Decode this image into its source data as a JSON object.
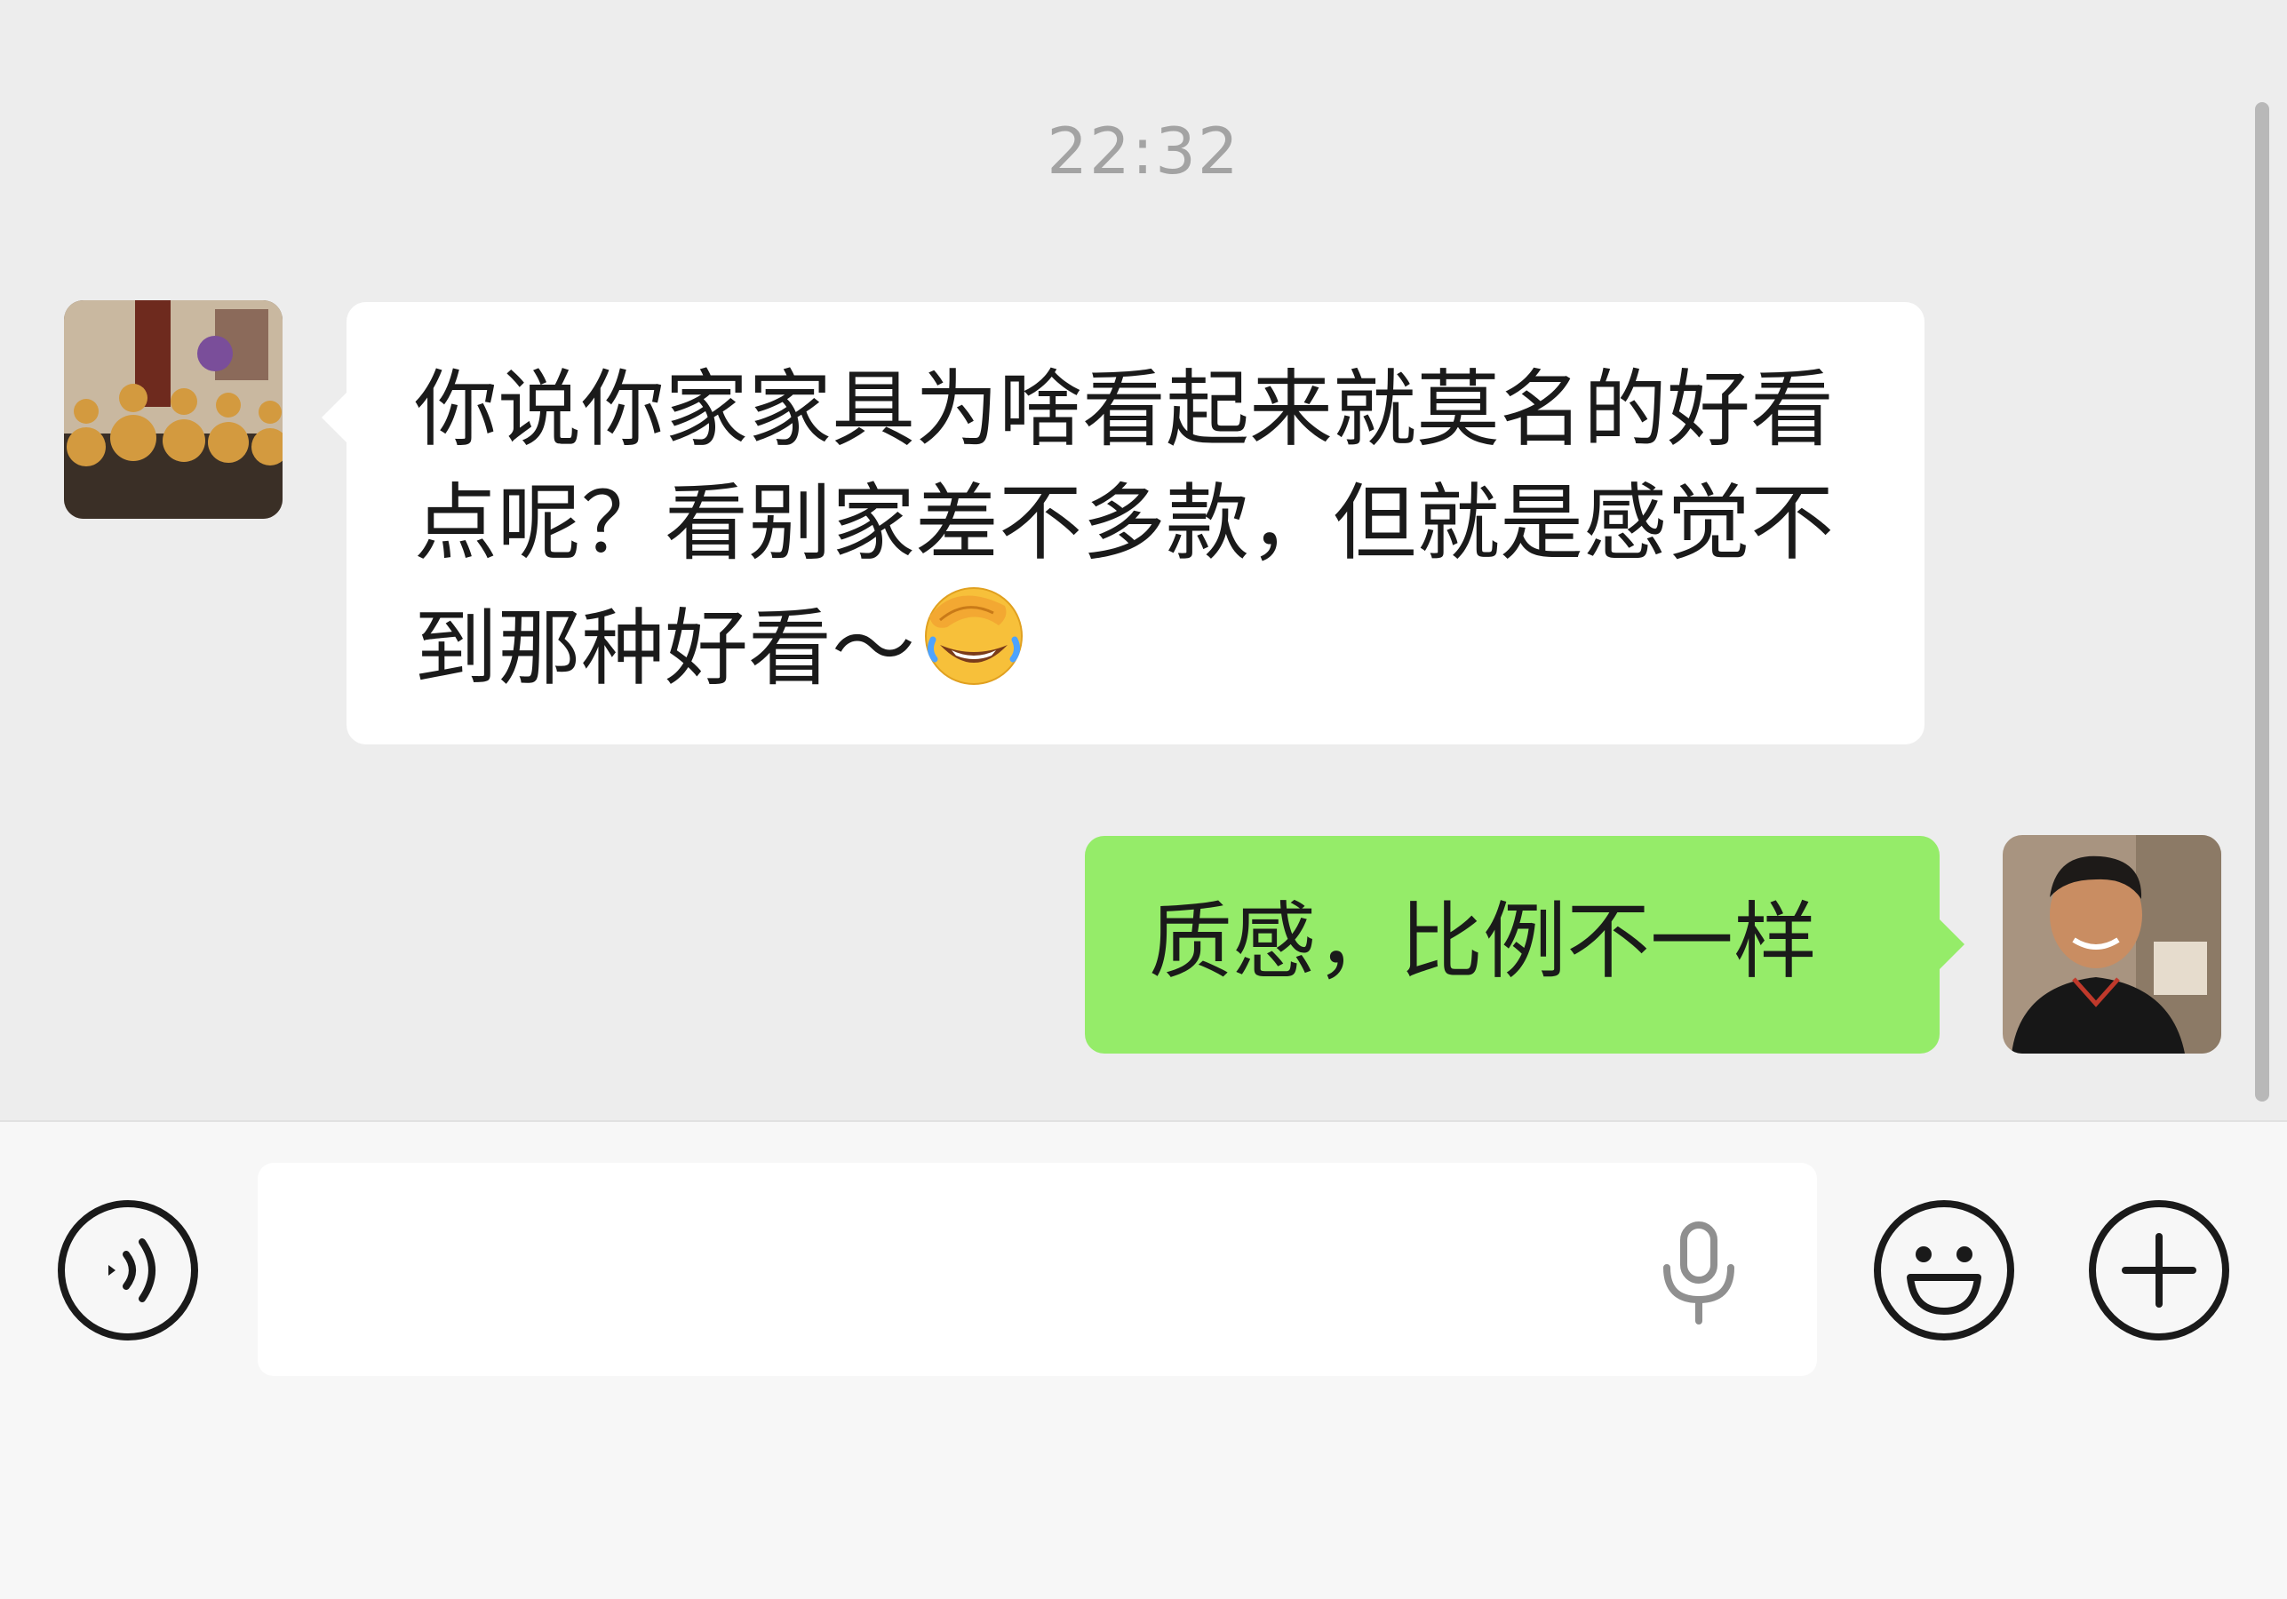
{
  "chat": {
    "timestamp": "22:32",
    "messages": [
      {
        "side": "left",
        "text": "你说你家家具为啥看起来就莫名的好看点呢？看别家差不多款，但就是感觉不到那种好看～",
        "emoji": "face-palm-laughing-emoji"
      },
      {
        "side": "right",
        "text": "质感，比例不一样"
      }
    ]
  },
  "input_bar": {
    "input_value": "",
    "icons": [
      "voice-icon",
      "microphone-icon",
      "emoji-icon",
      "plus-icon"
    ]
  },
  "colors": {
    "chat_background": "#ededed",
    "incoming_bubble": "#ffffff",
    "outgoing_bubble": "#95ec69",
    "timestamp_text": "#a3a3a3",
    "input_bar_background": "#f7f7f7"
  }
}
